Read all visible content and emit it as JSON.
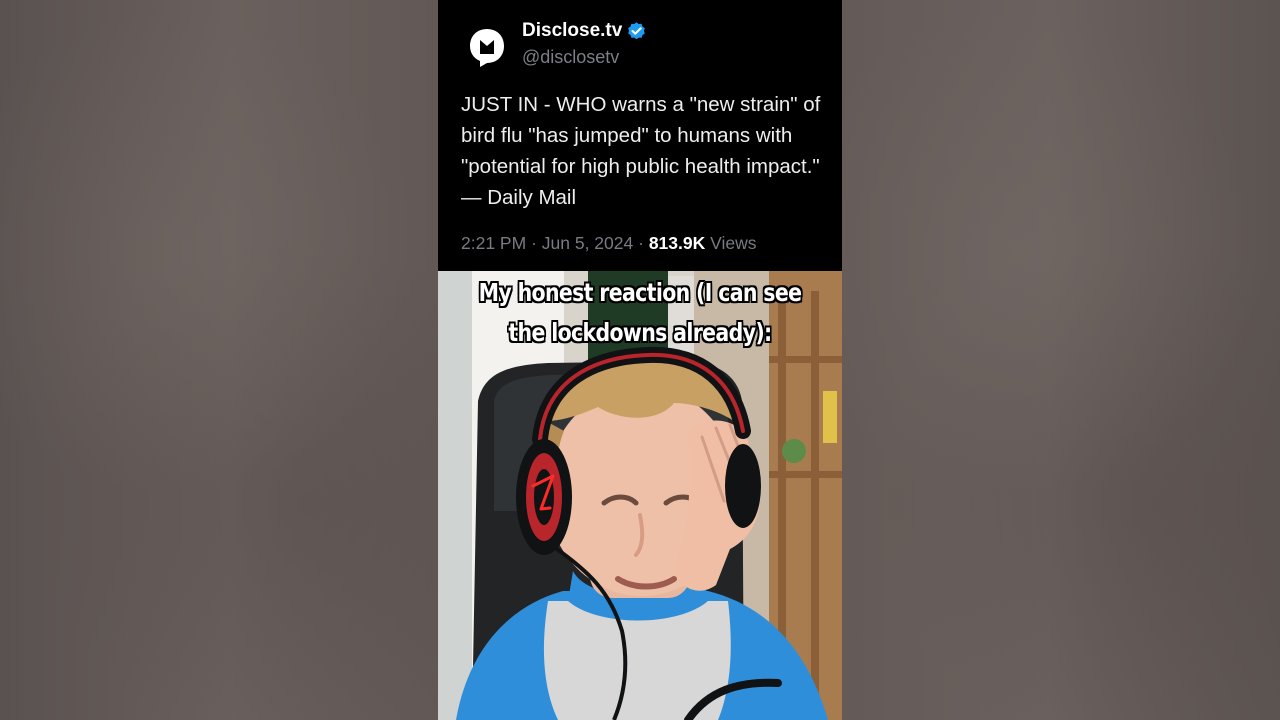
{
  "tweet": {
    "author_name": "Disclose.tv",
    "handle": "@disclosetv",
    "text": "JUST IN - WHO warns a \"new strain\" of bird flu \"has jumped\" to humans with \"potential for high public health impact.\" — Daily Mail",
    "time": "2:21 PM",
    "separator": "·",
    "date": "Jun 5, 2024",
    "views_count": "813.9K",
    "views_label": "Views",
    "avatar_icon": "disclose-logo-icon",
    "verified_icon": "verified-badge-icon",
    "verified_color": "#1d9bf0"
  },
  "video": {
    "caption_line1": "My honest reaction (I can see",
    "caption_line2": "the lockdowns already):"
  },
  "colors": {
    "tweet_background": "#000000",
    "tweet_text": "#e7e9ea",
    "meta_text": "#777c81",
    "caption_text": "#ffffff",
    "side_background": "#5f5755"
  }
}
